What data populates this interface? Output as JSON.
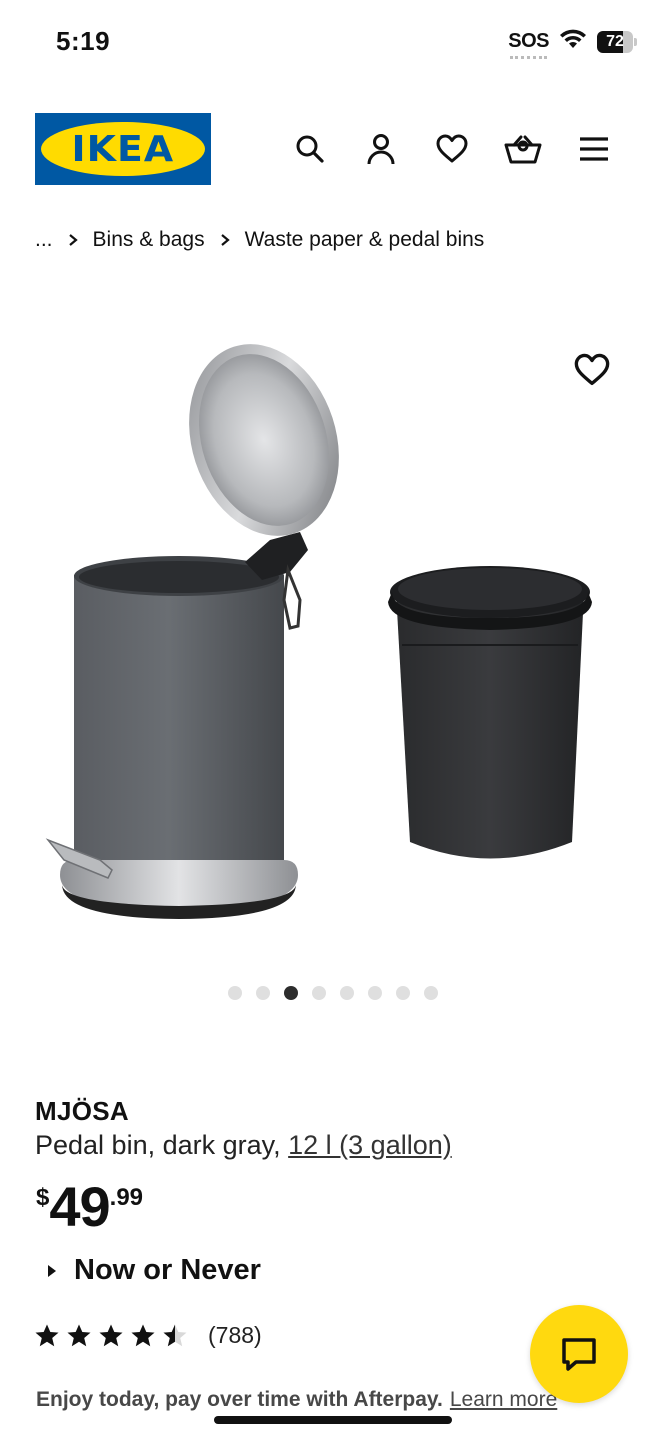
{
  "status_bar": {
    "time": "5:19",
    "sos": "SOS",
    "battery": "72"
  },
  "header": {
    "logo_text": "IKEA",
    "icons": [
      "search-icon",
      "account-icon",
      "wishlist-icon",
      "cart-icon",
      "menu-icon"
    ]
  },
  "breadcrumb": {
    "ellipsis": "...",
    "items": [
      "Bins & bags",
      "Waste paper & pedal bins"
    ]
  },
  "product": {
    "name": "MJÖSA",
    "description": "Pedal bin, dark gray, ",
    "size": "12 l (3 gallon)",
    "price_currency": "$",
    "price_integer": "49",
    "price_decimal": ".99",
    "promo": "Now or Never",
    "rating_value": 4.5,
    "rating_max": 5,
    "review_count": "(788)",
    "afterpay_text": "Enjoy today, pay over time with Afterpay.",
    "afterpay_link": "Learn more"
  },
  "carousel": {
    "total": 8,
    "active_index": 2
  },
  "colors": {
    "ikea_blue": "#0058a3",
    "ikea_yellow": "#ffdb00",
    "chat_yellow": "#ffd90f",
    "bin_gray": "#55585d"
  }
}
